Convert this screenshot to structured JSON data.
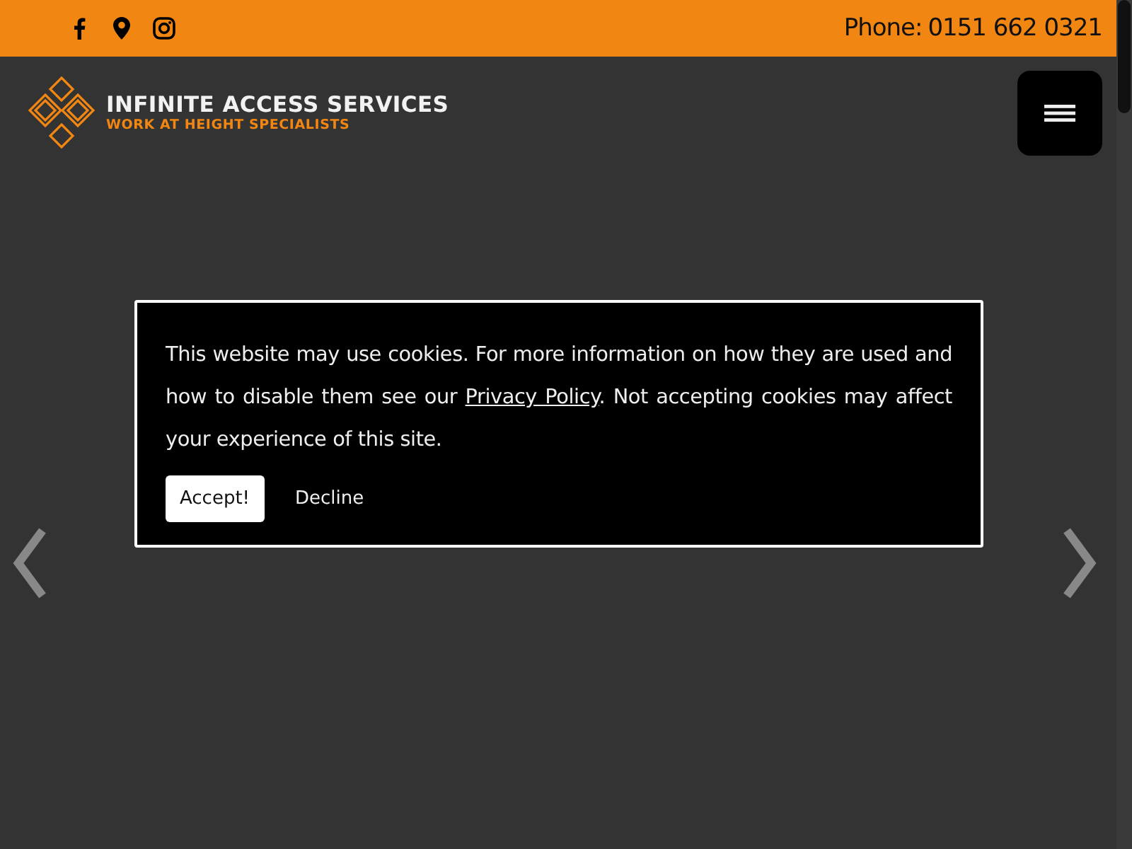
{
  "top_bar": {
    "social_icons": [
      {
        "kind": "facebook"
      },
      {
        "kind": "location"
      },
      {
        "kind": "instagram"
      }
    ],
    "phone_label": "Phone:",
    "phone_number": "0151 662 0321"
  },
  "header": {
    "logo_title": "INFINITE ACCESS SERVICES",
    "logo_tagline": "WORK AT HEIGHT SPECIALISTS"
  },
  "cookie_notice": {
    "text_before": "This website may use cookies. For more information on how they are used and how to disable them see our",
    "link": "Privacy Policy",
    "text_after": ". Not accepting cookies may affect your experience of this site.",
    "buttons": [
      {
        "label": "Accept!",
        "kind": "primary"
      },
      {
        "label": "Decline",
        "kind": "plain"
      }
    ]
  },
  "slider": {
    "arrows": [
      {
        "kind": "previous"
      },
      {
        "kind": "next"
      }
    ]
  }
}
